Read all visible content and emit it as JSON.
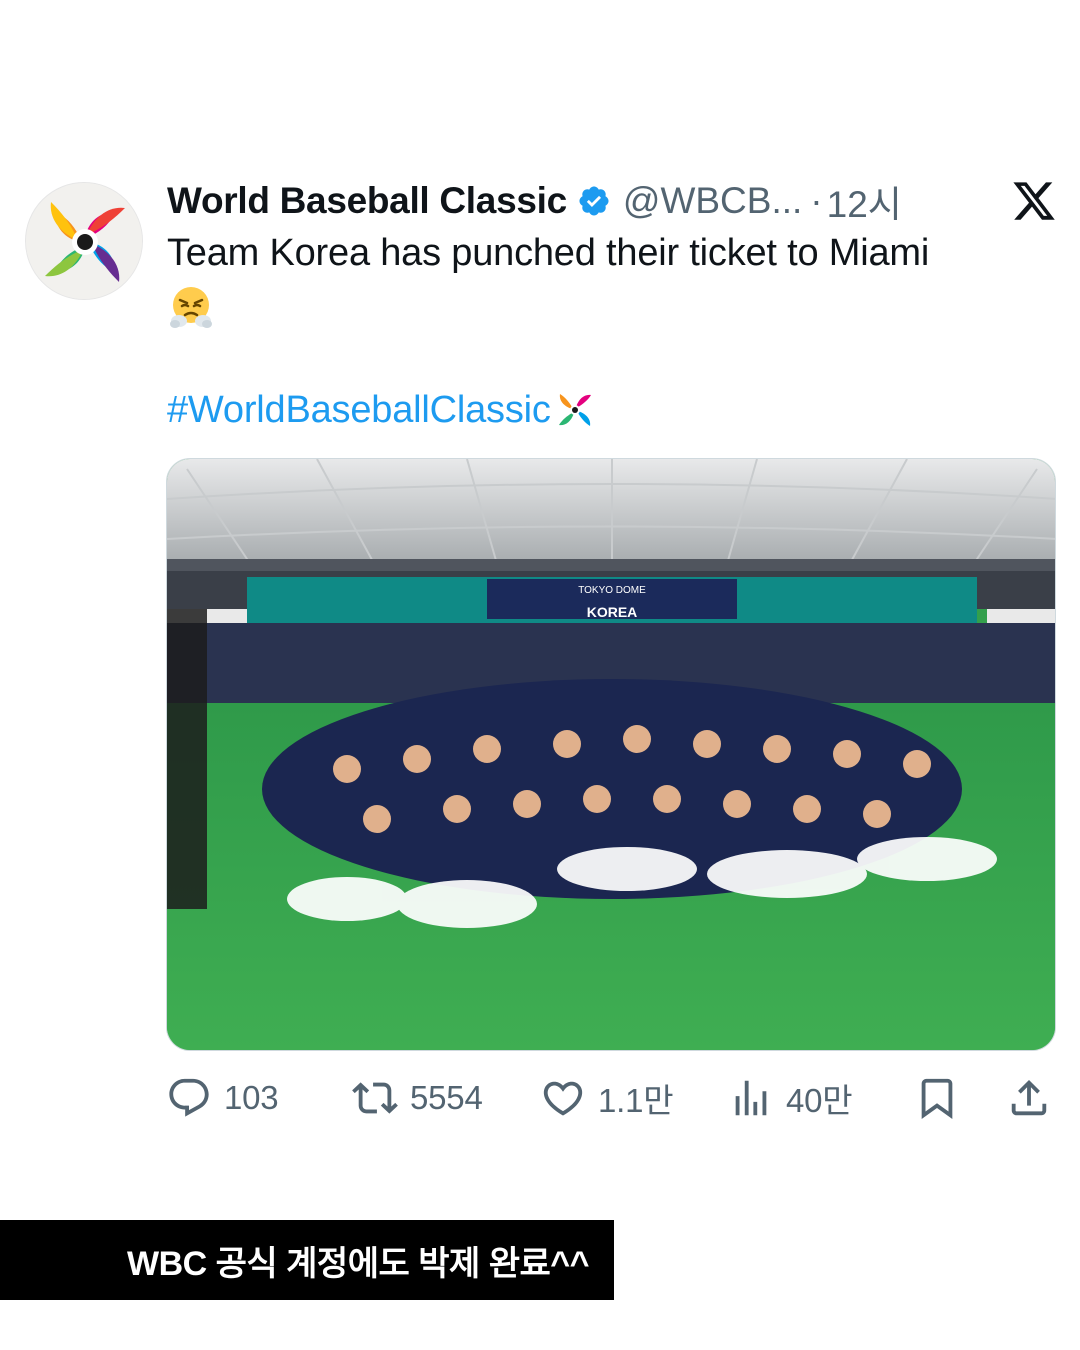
{
  "tweet": {
    "display_name": "World Baseball Classic",
    "handle": "@WBCB...",
    "separator": "·",
    "time": "12시",
    "text": "Team Korea has punched their ticket to Miami",
    "emoji": "face-with-steam-from-nose",
    "hashtag": "#WorldBaseballClassic",
    "media": {
      "description_icon": "team-photo",
      "ribbon_text": "TOKYO DOME",
      "banner_text": "KOREA"
    }
  },
  "actions": {
    "replies": "103",
    "retweets": "5554",
    "likes": "1.1만",
    "views": "40만"
  },
  "caption": "WBC 공식 계정에도 박제 완료^^",
  "colors": {
    "hashtag": "#1d9bf0",
    "verified": "#1d9bf0",
    "muted": "#536471",
    "caption_bg": "#000000"
  }
}
